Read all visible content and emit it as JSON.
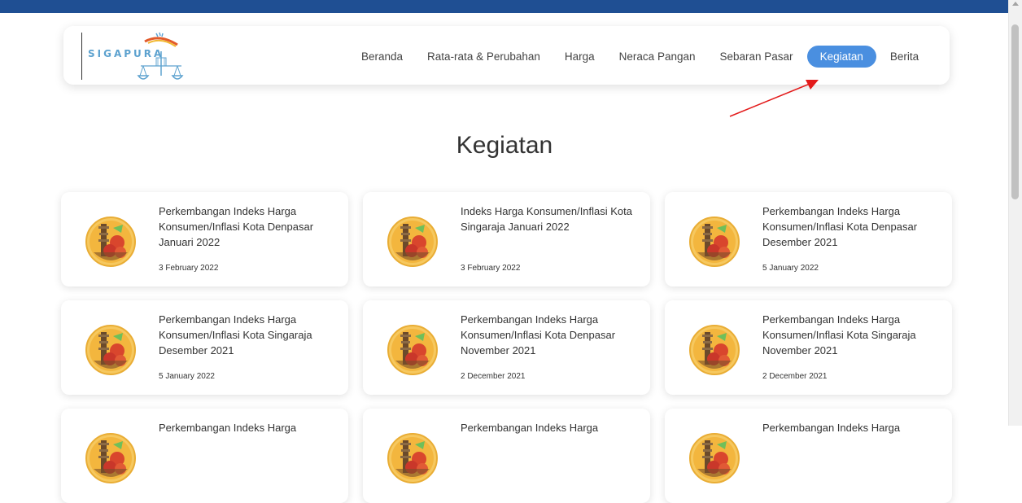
{
  "brand": {
    "logo_text": "SIGAPURA"
  },
  "nav": {
    "items": [
      {
        "label": "Beranda",
        "active": false
      },
      {
        "label": "Rata-rata & Perubahan",
        "active": false
      },
      {
        "label": "Harga",
        "active": false
      },
      {
        "label": "Neraca Pangan",
        "active": false
      },
      {
        "label": "Sebaran Pasar",
        "active": false
      },
      {
        "label": "Kegiatan",
        "active": true
      },
      {
        "label": "Berita",
        "active": false
      }
    ]
  },
  "page": {
    "title": "Kegiatan"
  },
  "cards": [
    {
      "title": "Perkembangan Indeks Harga Konsumen/Inflasi Kota Denpasar Januari 2022",
      "date": "3 February 2022"
    },
    {
      "title": "Indeks Harga Konsumen/Inflasi Kota Singaraja Januari 2022",
      "date": "3 February 2022"
    },
    {
      "title": "Perkembangan Indeks Harga Konsumen/Inflasi Kota Denpasar Desember 2021",
      "date": "5 January 2022"
    },
    {
      "title": "Perkembangan Indeks Harga Konsumen/Inflasi Kota Singaraja Desember 2021",
      "date": "5 January 2022"
    },
    {
      "title": "Perkembangan Indeks Harga Konsumen/Inflasi Kota Denpasar November 2021",
      "date": "2 December 2021"
    },
    {
      "title": "Perkembangan Indeks Harga Konsumen/Inflasi Kota Singaraja November 2021",
      "date": "2 December 2021"
    },
    {
      "title": "Perkembangan Indeks Harga",
      "date": ""
    },
    {
      "title": "Perkembangan Indeks Harga",
      "date": ""
    },
    {
      "title": "Perkembangan Indeks Harga",
      "date": ""
    }
  ],
  "colors": {
    "topbar": "#1f4f93",
    "accent": "#4a8fe0",
    "annotation_arrow": "#e31b1b"
  }
}
